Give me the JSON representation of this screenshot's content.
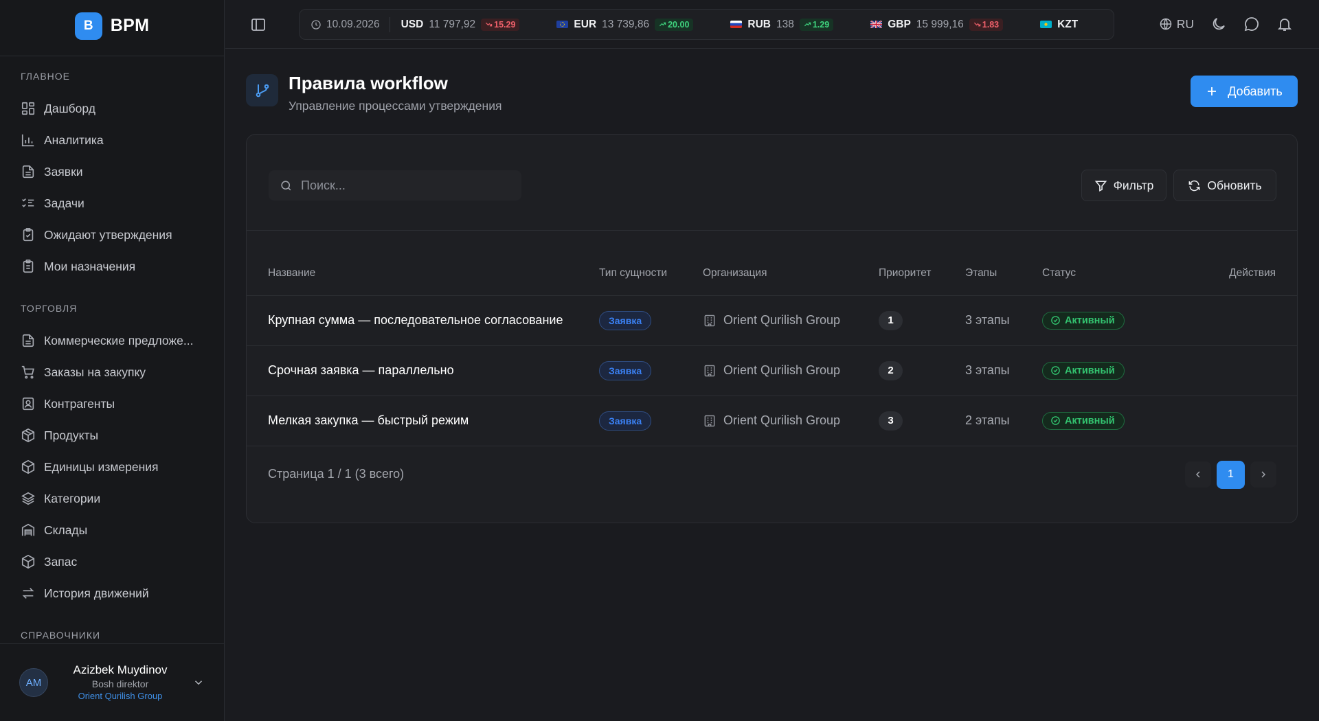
{
  "brand": {
    "logo_letter": "B",
    "name": "BPM"
  },
  "sidebar": {
    "sections": [
      {
        "title": "ГЛАВНОЕ",
        "items": [
          {
            "label": "Дашборд",
            "icon": "dashboard-icon"
          },
          {
            "label": "Аналитика",
            "icon": "bar-chart-icon"
          },
          {
            "label": "Заявки",
            "icon": "document-icon"
          },
          {
            "label": "Задачи",
            "icon": "list-checks-icon"
          },
          {
            "label": "Ожидают утверждения",
            "icon": "clipboard-check-icon"
          },
          {
            "label": "Мои назначения",
            "icon": "clipboard-list-icon"
          }
        ]
      },
      {
        "title": "ТОРГОВЛЯ",
        "items": [
          {
            "label": "Коммерческие предложе...",
            "icon": "document-icon"
          },
          {
            "label": "Заказы на закупку",
            "icon": "cart-icon"
          },
          {
            "label": "Контрагенты",
            "icon": "contact-icon"
          },
          {
            "label": "Продукты",
            "icon": "box-icon"
          },
          {
            "label": "Единицы измерения",
            "icon": "box-icon"
          },
          {
            "label": "Категории",
            "icon": "layers-icon"
          },
          {
            "label": "Склады",
            "icon": "warehouse-icon"
          },
          {
            "label": "Запас",
            "icon": "box-icon"
          },
          {
            "label": "История движений",
            "icon": "arrows-exchange-icon"
          }
        ]
      },
      {
        "title": "СПРАВОЧНИКИ",
        "items": []
      }
    ]
  },
  "user": {
    "initials": "AM",
    "name": "Azizbek Muydinov",
    "role": "Bosh direktor",
    "org": "Orient Qurilish Group"
  },
  "ticker": {
    "date": "10.09.2026",
    "rates": [
      {
        "code": "USD",
        "value": "11 797,92",
        "change": "15.29",
        "direction": "down"
      },
      {
        "code": "EUR",
        "value": "13 739,86",
        "change": "20.00",
        "direction": "up"
      },
      {
        "code": "RUB",
        "value": "138",
        "change": "1.29",
        "direction": "up"
      },
      {
        "code": "GBP",
        "value": "15 999,16",
        "change": "1.83",
        "direction": "down"
      },
      {
        "code": "KZT",
        "value": "",
        "change": "",
        "direction": ""
      }
    ]
  },
  "topbar": {
    "lang": "RU"
  },
  "page": {
    "title": "Правила workflow",
    "subtitle": "Управление процессами утверждения",
    "add_label": "Добавить"
  },
  "toolbar": {
    "search_placeholder": "Поиск...",
    "filter_label": "Фильтр",
    "refresh_label": "Обновить"
  },
  "table": {
    "headers": {
      "name": "Название",
      "type": "Тип сущности",
      "org": "Организация",
      "priority": "Приоритет",
      "stages": "Этапы",
      "status": "Статус",
      "actions": "Действия"
    },
    "rows": [
      {
        "name": "Крупная сумма — последовательное согласование",
        "type": "Заявка",
        "org": "Orient Qurilish Group",
        "priority": "1",
        "stages": "3 этапы",
        "status": "Активный"
      },
      {
        "name": "Срочная заявка — параллельно",
        "type": "Заявка",
        "org": "Orient Qurilish Group",
        "priority": "2",
        "stages": "3 этапы",
        "status": "Активный"
      },
      {
        "name": "Мелкая закупка — быстрый режим",
        "type": "Заявка",
        "org": "Orient Qurilish Group",
        "priority": "3",
        "stages": "2 этапы",
        "status": "Активный"
      }
    ]
  },
  "pagination": {
    "info": "Страница 1 / 1 (3 всего)",
    "current_page": "1"
  },
  "colors": {
    "accent": "#2f8cf0",
    "success": "#33c470",
    "danger": "#f0616b",
    "background": "#1a1b1f"
  }
}
